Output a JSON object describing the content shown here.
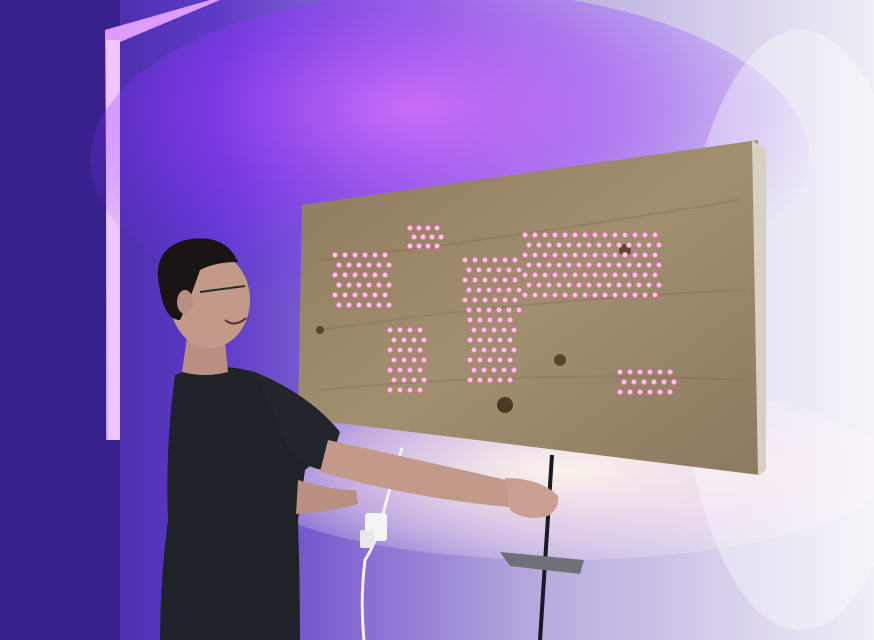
{
  "photo": {
    "subject": "",
    "colors": {
      "wall_left": "#4b2fb0",
      "wall_right": "#f2eef7",
      "glow_purple": "#b23cff",
      "glow_warm": "#fff6e8",
      "wood": "#9a8a6e",
      "dot_light": "#ffb2d8",
      "shirt": "#1f2228",
      "skin": "#c39a8a"
    },
    "icons": [
      "world-map-dots-icon",
      "power-adapter-icon"
    ]
  }
}
